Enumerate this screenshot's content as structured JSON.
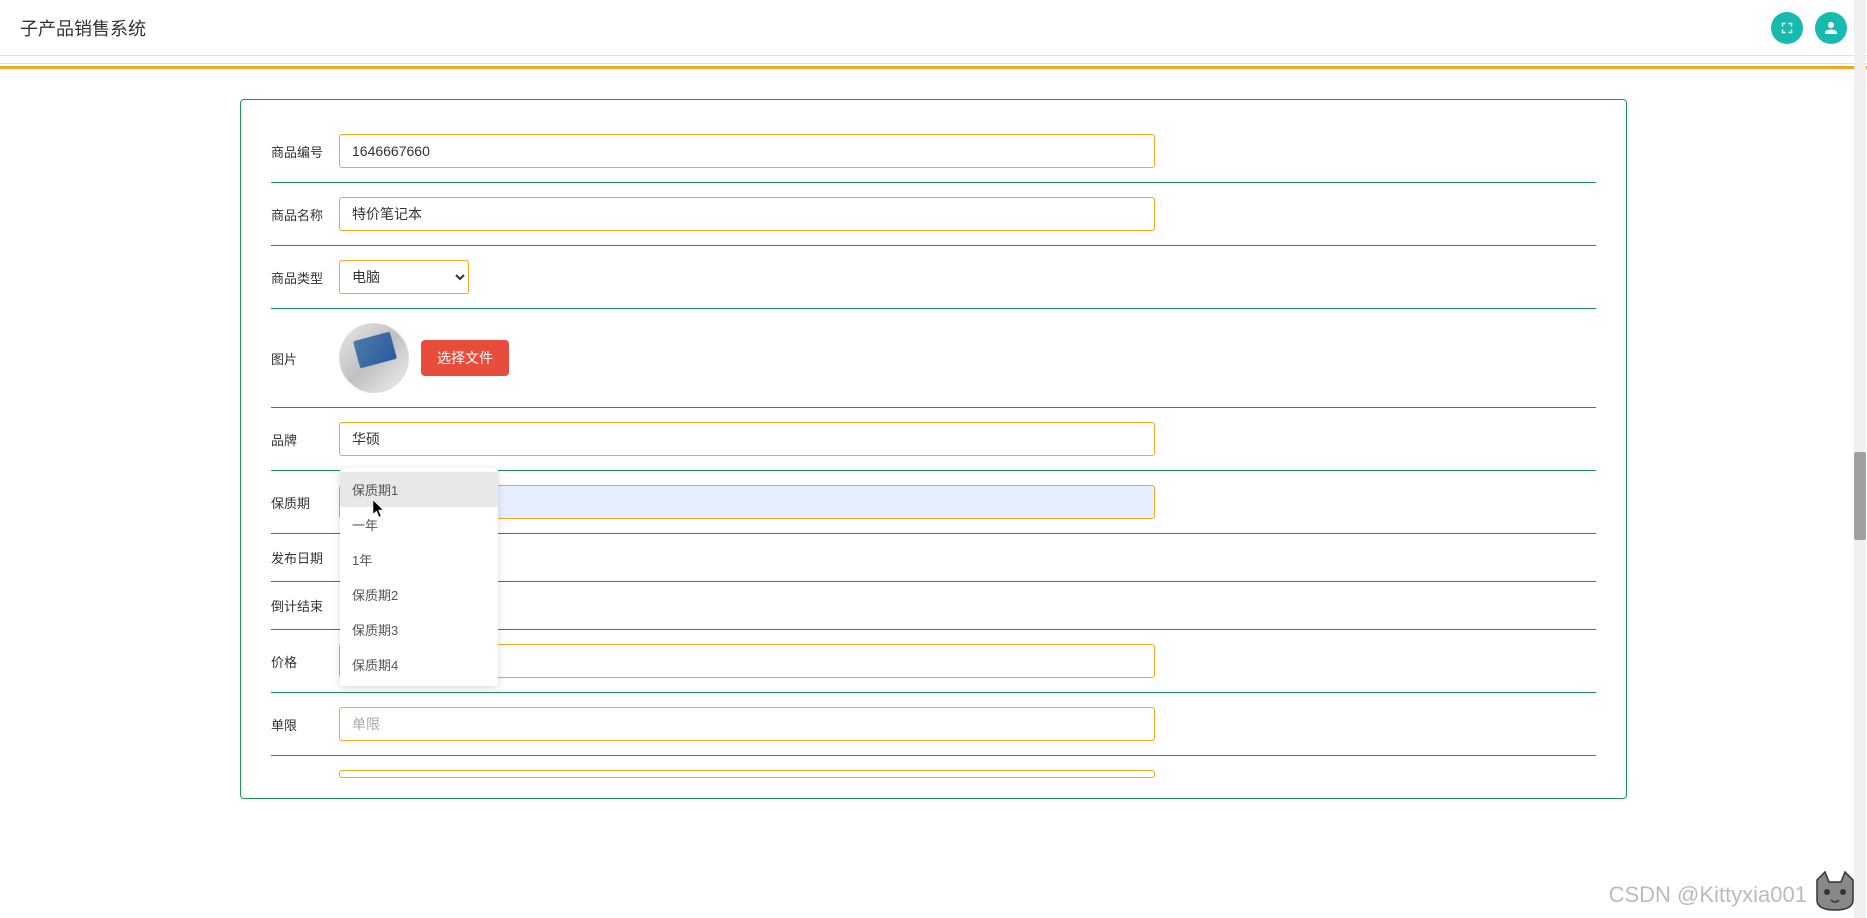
{
  "header": {
    "title": "子产品销售系统"
  },
  "form": {
    "product_id": {
      "label": "商品编号",
      "value": "1646667660"
    },
    "product_name": {
      "label": "商品名称",
      "value": "特价笔记本"
    },
    "product_type": {
      "label": "商品类型",
      "selected": "电脑"
    },
    "image": {
      "label": "图片",
      "upload_button": "选择文件"
    },
    "brand": {
      "label": "品牌",
      "value": "华硕"
    },
    "shelf_life": {
      "label": "保质期",
      "value": "保质期1"
    },
    "publish_date": {
      "label": "发布日期"
    },
    "countdown_end": {
      "label": "倒计结束"
    },
    "price": {
      "label": "价格"
    },
    "single_limit": {
      "label": "单限",
      "placeholder": "单限"
    }
  },
  "dropdown": {
    "options": [
      "保质期1",
      "一年",
      "1年",
      "保质期2",
      "保质期3",
      "保质期4"
    ]
  },
  "watermark": "CSDN @Kittyxia001"
}
